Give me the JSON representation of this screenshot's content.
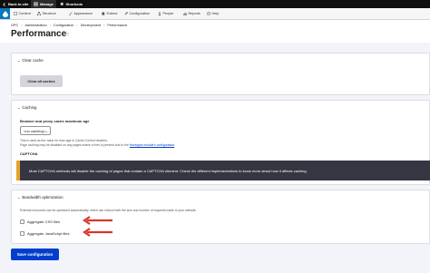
{
  "toolbar": {
    "back_label": "Back to site",
    "manage_label": "Manage",
    "shortcuts_label": "Shortcuts"
  },
  "tray": {
    "items": [
      "Content",
      "Structure",
      "Appearance",
      "Extend",
      "Configuration",
      "People",
      "Reports",
      "Help"
    ]
  },
  "breadcrumb": [
    "OPC",
    "Administration",
    "Configuration",
    "Development",
    "Performance"
  ],
  "page": {
    "title": "Performance"
  },
  "clear_cache": {
    "summary": "Clear cache",
    "button": "Clear all caches"
  },
  "caching": {
    "summary": "Caching",
    "label": "Browser and proxy cache maximum age",
    "select_value": "<no caching>",
    "desc_line1": "This is used as the value for max-age in Cache-Control headers.",
    "desc_line2_pre": "Page caching may be disabled on any pages where a form is present due to the",
    "desc_link": "Honeypot module's configuration",
    "desc_line2_post": ".",
    "captcha_label": "CAPTCHA"
  },
  "warning": {
    "text": "Most CAPTCHA methods will disable the caching of pages that contain a CAPTCHA element. Check the different implementations to know more about how it affects caching."
  },
  "bandwidth": {
    "summary": "Bandwidth optimization",
    "desc": "External resources can be optimized automatically, which can reduce both the size and number of requests made to your website.",
    "css_label": "Aggregate CSS files",
    "js_label": "Aggregate JavaScript files"
  },
  "save_button": "Save configuration",
  "colors": {
    "primary": "#003ecc",
    "warning_border": "#e4a32f",
    "annotation_arrow": "#d9342b"
  }
}
